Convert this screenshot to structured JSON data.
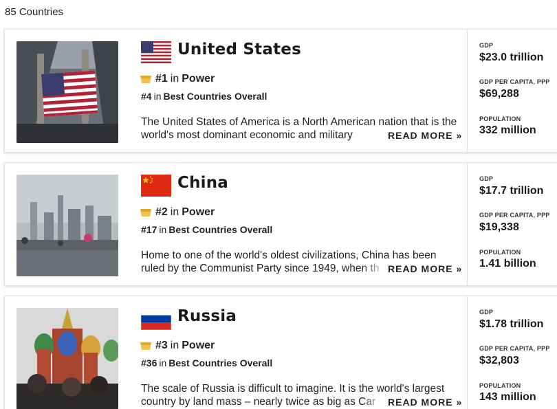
{
  "results": {
    "count_label": "85 Countries"
  },
  "countries": [
    {
      "name": "United States",
      "flag": "us-flag",
      "photo": "new-york-stock-exchange-with-flag",
      "rank_power_prefix": "#1",
      "rank_power_in": "in",
      "rank_power_category": "Power",
      "rank_overall_prefix": "#4",
      "rank_overall_in": "in",
      "rank_overall_category": "Best Countries Overall",
      "description": "The United States of America is a North American nation that is the world's most dominant economic and military",
      "read_more": "READ MORE »",
      "stats": {
        "gdp_label": "GDP",
        "gdp": "$23.0 trillion",
        "gdp_ppp_label": "GDP PER CAPITA, PPP",
        "gdp_ppp": "$69,288",
        "population_label": "POPULATION",
        "population": "332 million"
      }
    },
    {
      "name": "China",
      "flag": "china-flag",
      "photo": "shanghai-skyline-rainy",
      "rank_power_prefix": "#2",
      "rank_power_in": "in",
      "rank_power_category": "Power",
      "rank_overall_prefix": "#17",
      "rank_overall_in": "in",
      "rank_overall_category": "Best Countries Overall",
      "description": "Home to one of the world's oldest civilizations, China has been ruled by the Communist Party since 1949, when th",
      "read_more": "READ MORE »",
      "stats": {
        "gdp_label": "GDP",
        "gdp": "$17.7 trillion",
        "gdp_ppp_label": "GDP PER CAPITA, PPP",
        "gdp_ppp": "$19,338",
        "population_label": "POPULATION",
        "population": "1.41 billion"
      }
    },
    {
      "name": "Russia",
      "flag": "russia-flag",
      "photo": "st-basils-cathedral",
      "rank_power_prefix": "#3",
      "rank_power_in": "in",
      "rank_power_category": "Power",
      "rank_overall_prefix": "#36",
      "rank_overall_in": "in",
      "rank_overall_category": "Best Countries Overall",
      "description": "The scale of Russia is difficult to imagine. It is the world's largest country by land mass – nearly twice as big as Car",
      "read_more": "READ MORE »",
      "stats": {
        "gdp_label": "GDP",
        "gdp": "$1.78 trillion",
        "gdp_ppp_label": "GDP PER CAPITA, PPP",
        "gdp_ppp": "$32,803",
        "population_label": "POPULATION",
        "population": "143 million"
      }
    }
  ],
  "colors": {
    "medal": "#f2c14e",
    "us_red": "#b22234",
    "us_blue": "#3c3b6e",
    "china_red": "#de2910",
    "china_yellow": "#ffde00",
    "russia_blue": "#0039a6",
    "russia_red": "#d52b1e"
  }
}
